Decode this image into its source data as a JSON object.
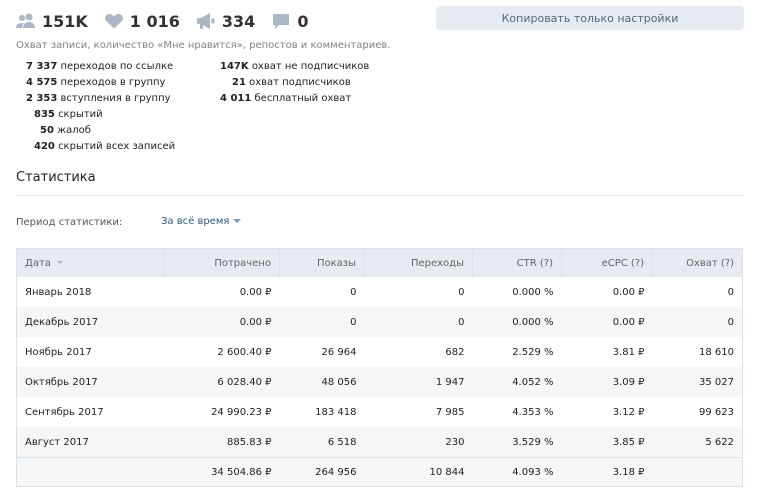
{
  "top_stats": {
    "reach": "151K",
    "likes": "1 016",
    "reposts": "334",
    "comments": "0"
  },
  "copy_button_label": "Копировать только настройки",
  "subtitle": "Охват записи, количество «Мне нравится», репостов и комментариев.",
  "metrics_left": [
    {
      "num": "7 337",
      "label": "переходов по ссылке"
    },
    {
      "num": "4 575",
      "label": "переходов в группу"
    },
    {
      "num": "2 353",
      "label": "вступления в группу"
    },
    {
      "num": "835",
      "label": "скрытий"
    },
    {
      "num": "50",
      "label": "жалоб"
    },
    {
      "num": "420",
      "label": "скрытий всех записей"
    }
  ],
  "metrics_right": [
    {
      "num": "147K",
      "label": "охват не подписчиков"
    },
    {
      "num": "21",
      "label": "охват подписчиков"
    },
    {
      "num": "4 011",
      "label": "бесплатный охват"
    }
  ],
  "section_title": "Статистика",
  "period": {
    "label": "Период статистики:",
    "value": "За всё время"
  },
  "table": {
    "headers": [
      "Дата",
      "Потрачено",
      "Показы",
      "Переходы",
      "CTR (?)",
      "eCPC (?)",
      "Охват (?)"
    ],
    "rows": [
      [
        "Январь 2018",
        "0.00 ₽",
        "0",
        "0",
        "0.000 %",
        "0.00 ₽",
        "0"
      ],
      [
        "Декабрь 2017",
        "0.00 ₽",
        "0",
        "0",
        "0.000 %",
        "0.00 ₽",
        "0"
      ],
      [
        "Ноябрь 2017",
        "2 600.40 ₽",
        "26 964",
        "682",
        "2.529 %",
        "3.81 ₽",
        "18 610"
      ],
      [
        "Октябрь 2017",
        "6 028.40 ₽",
        "48 056",
        "1 947",
        "4.052 %",
        "3.09 ₽",
        "35 027"
      ],
      [
        "Сентябрь 2017",
        "24 990.23 ₽",
        "183 418",
        "7 985",
        "4.353 %",
        "3.12 ₽",
        "99 623"
      ],
      [
        "Август 2017",
        "885.83 ₽",
        "6 518",
        "230",
        "3.529 %",
        "3.85 ₽",
        "5 622"
      ]
    ],
    "total": [
      "",
      "34 504.86 ₽",
      "264 956",
      "10 844",
      "4.093 %",
      "3.18 ₽",
      ""
    ]
  },
  "colors": {
    "accent": "#2a5885",
    "header_bg": "#e6ebf1",
    "icon": "#aab8c6"
  }
}
